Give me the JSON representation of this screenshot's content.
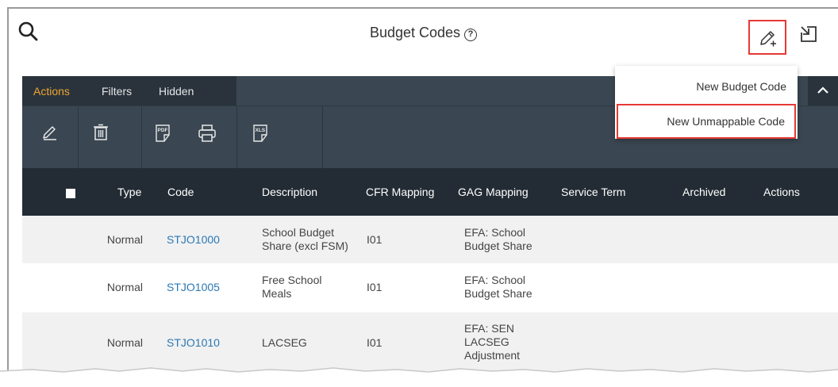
{
  "header": {
    "title": "Budget Codes",
    "help_glyph": "?"
  },
  "toolbar": {
    "tabs": [
      {
        "label": "Actions",
        "active": true
      },
      {
        "label": "Filters",
        "active": false
      },
      {
        "label": "Hidden",
        "active": false
      }
    ],
    "tools": [
      "edit-icon",
      "delete-icon",
      "pdf-icon",
      "print-icon",
      "xls-icon"
    ],
    "pdf_text": "PDF",
    "xls_text": "XLS"
  },
  "new_menu": {
    "items": [
      {
        "label": "New Budget Code",
        "highlighted": false
      },
      {
        "label": "New Unmappable Code",
        "highlighted": true
      }
    ]
  },
  "table": {
    "columns": [
      "Type",
      "Code",
      "Description",
      "CFR Mapping",
      "GAG Mapping",
      "Service Term",
      "Archived",
      "Actions"
    ],
    "rows": [
      {
        "type": "Normal",
        "code": "STJO1000",
        "description": [
          "School Budget",
          "Share (excl FSM)"
        ],
        "cfr": "I01",
        "gag": [
          "EFA: School",
          "Budget Share"
        ],
        "service_term": "",
        "archived": ""
      },
      {
        "type": "Normal",
        "code": "STJO1005",
        "description": [
          "Free School",
          "Meals"
        ],
        "cfr": "I01",
        "gag": [
          "EFA: School",
          "Budget Share"
        ],
        "service_term": "",
        "archived": ""
      },
      {
        "type": "Normal",
        "code": "STJO1010",
        "description": [
          "LACSEG"
        ],
        "cfr": "I01",
        "gag": [
          "EFA: SEN",
          "LACSEG",
          "Adjustment"
        ],
        "service_term": "",
        "archived": ""
      }
    ]
  },
  "colors": {
    "accent_tab": "#f0a530",
    "toolbar_bg": "#3a4651",
    "header_bg": "#232c34",
    "highlight": "#e53935",
    "link": "#2a78b4"
  }
}
